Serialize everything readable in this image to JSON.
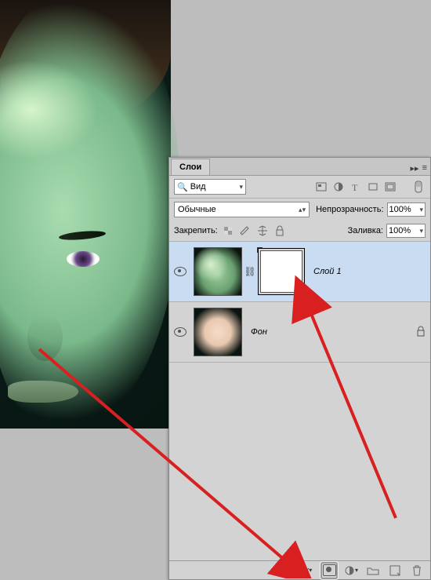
{
  "panel": {
    "tab": "Слои",
    "filter": {
      "label": "Вид"
    },
    "blend_mode": "Обычные",
    "opacity_label": "Непрозрачность:",
    "opacity_value": "100%",
    "fill_label": "Заливка:",
    "fill_value": "100%",
    "lock_label": "Закрепить:"
  },
  "layers": [
    {
      "name": "Слой 1",
      "selected": true,
      "has_mask": true,
      "locked": false
    },
    {
      "name": "Фон",
      "selected": false,
      "has_mask": false,
      "locked": true
    }
  ],
  "bottom_icons": {
    "link": "link-icon",
    "fx": "fx",
    "mask": "add-mask-icon",
    "adjust": "adjustment-icon",
    "group": "group-icon",
    "new": "new-layer-icon",
    "trash": "trash-icon"
  }
}
